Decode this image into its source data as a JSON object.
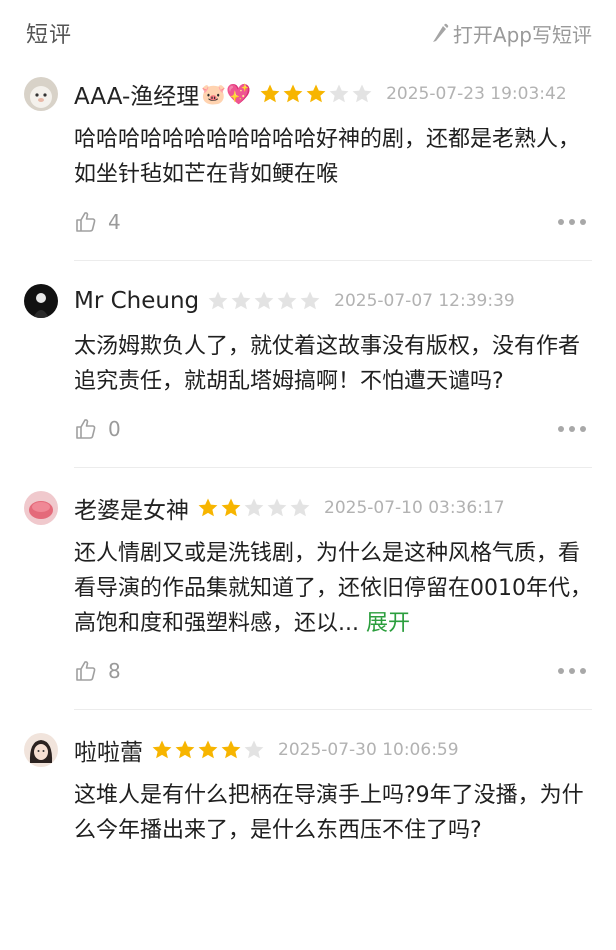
{
  "header": {
    "title": "短评",
    "write_label": "打开App写短评"
  },
  "reviews": [
    {
      "username": "AAA-渔经理",
      "emoji": "🐷💖",
      "rating": 3,
      "date": "2025-07-23 19:03:42",
      "content": "哈哈哈哈哈哈哈哈哈哈哈好神的剧，还都是老熟人，如坐针毡如芒在背如鲠在喉",
      "likes": "4",
      "avatar_color": "#d8d2c8"
    },
    {
      "username": "Mr Cheung",
      "rating": 0,
      "date": "2025-07-07 12:39:39",
      "content": "太汤姆欺负人了，就仗着这故事没有版权，没有作者追究责任，就胡乱塔姆搞啊！不怕遭天谴吗?",
      "likes": "0",
      "avatar_color": "#111111"
    },
    {
      "username": "老婆是女神",
      "rating": 2,
      "date": "2025-07-10 03:36:17",
      "content": "还人情剧又或是洗钱剧，为什么是这种风格气质，看看导演的作品集就知道了，还依旧停留在0010年代，高饱和度和强塑料感，还以...",
      "expand_label": "展开",
      "likes": "8",
      "avatar_color": "#e46a7a"
    },
    {
      "username": "啦啦蕾",
      "rating": 4,
      "date": "2025-07-30 10:06:59",
      "content": "这堆人是有什么把柄在导演手上吗?9年了没播，为什么今年播出来了，是什么东西压不住了吗?",
      "avatar_color": "#f1e4dc"
    }
  ],
  "colors": {
    "star_on": "#f7b500",
    "star_off": "#e3e3e3",
    "accent": "#2b9e3d"
  }
}
